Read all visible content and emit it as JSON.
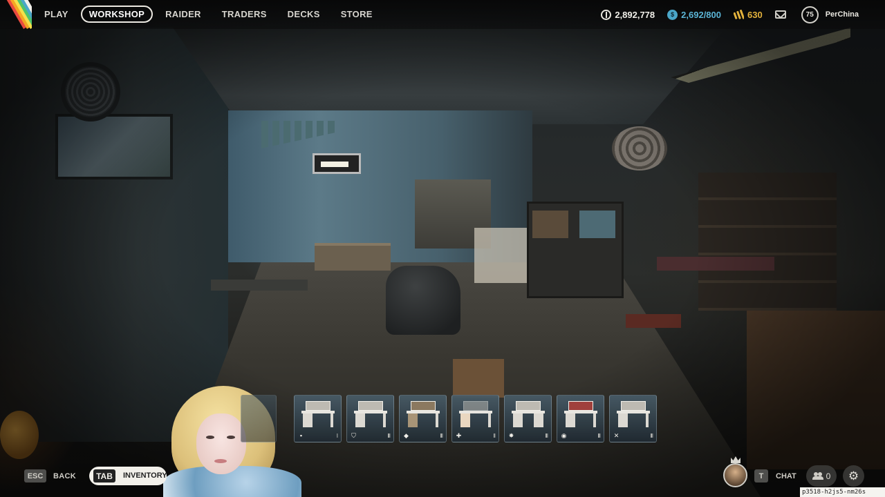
{
  "topbar": {
    "nav": [
      {
        "label": "PLAY",
        "active": false
      },
      {
        "label": "WORKSHOP",
        "active": true
      },
      {
        "label": "RAIDER",
        "active": false
      },
      {
        "label": "TRADERS",
        "active": false
      },
      {
        "label": "DECKS",
        "active": false
      },
      {
        "label": "STORE",
        "active": false
      }
    ],
    "currencies": {
      "coins": {
        "value": "2,892,778",
        "icon": "coins-icon",
        "color": "#f1efe9"
      },
      "credits": {
        "value": "2,692/800",
        "icon": "credits-icon",
        "color": "#5bb5d6"
      },
      "raider_tokens": {
        "value": "630",
        "icon": "raider-token-icon",
        "color": "#e3b23c"
      }
    },
    "mail_icon": "mail-icon",
    "player": {
      "level": "75",
      "name": "PerChina"
    }
  },
  "workstations": [
    {
      "name": "workbench",
      "type_icon": "crate-icon",
      "type_glyph": "▪",
      "level": "I"
    },
    {
      "name": "gunsmith",
      "type_icon": "shield-icon",
      "type_glyph": "⛉",
      "level": "III"
    },
    {
      "name": "gear-bench",
      "type_icon": "armor-icon",
      "type_glyph": "◆",
      "level": "III"
    },
    {
      "name": "medical-lab",
      "type_icon": "medical-cross-icon",
      "type_glyph": "✚",
      "level": "II"
    },
    {
      "name": "explosives-station",
      "type_icon": "explosive-icon",
      "type_glyph": "✸",
      "level": "III"
    },
    {
      "name": "utility-station",
      "type_icon": "utility-icon",
      "type_glyph": "◉",
      "level": "III"
    },
    {
      "name": "refiner",
      "type_icon": "tools-icon",
      "type_glyph": "✕",
      "level": "III"
    }
  ],
  "hints": {
    "back": {
      "key": "ESC",
      "label": "BACK"
    },
    "inventory": {
      "key": "TAB",
      "label": "INVENTORY"
    },
    "chat": {
      "key": "T",
      "label": "CHAT"
    }
  },
  "party": {
    "count": "0"
  },
  "settings_icon": "gear-icon",
  "session_id": "p3518-h2js5-nm26s",
  "logo_colors": [
    "#e94a3f",
    "#f5a623",
    "#f5e04a",
    "#4fc36b",
    "#4aa6c8",
    "#f2f0ea"
  ]
}
